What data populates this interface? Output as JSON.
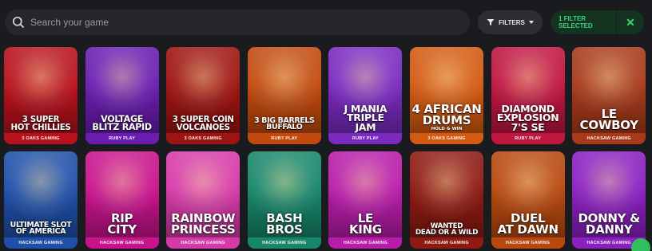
{
  "search": {
    "placeholder": "Search your game"
  },
  "filters": {
    "label": "FILTERS"
  },
  "filter_selected": {
    "label": "1 FILTER SELECTED",
    "close": "✕"
  },
  "games": [
    {
      "title_lines": [
        "3 SUPER",
        "HOT CHILLIES"
      ],
      "sub": "",
      "provider": "3 OAKS GAMING",
      "bg": "#b8121c"
    },
    {
      "title_lines": [
        "VOLTAGE",
        "BLITZ RAPID"
      ],
      "sub": "",
      "provider": "RUBY PLAY",
      "bg": "#6a1db0"
    },
    {
      "title_lines": [
        "3 SUPER COIN",
        "VOLCANOES"
      ],
      "sub": "",
      "provider": "3 OAKS GAMING",
      "bg": "#9e1410"
    },
    {
      "title_lines": [
        "3 BIG BARRELS",
        "BUFFALO"
      ],
      "sub": "",
      "provider": "RUBY PLAY",
      "bg": "#c24a0e"
    },
    {
      "title_lines": [
        "J MANIA",
        "TRIPLE",
        "JAM"
      ],
      "sub": "",
      "provider": "RUBY PLAY",
      "bg": "#7a2ac0"
    },
    {
      "title_lines": [
        "4 AFRICAN",
        "DRUMS"
      ],
      "sub": "HOLD & WIN",
      "provider": "3 OAKS GAMING",
      "bg": "#d35a10"
    },
    {
      "title_lines": [
        "DIAMOND",
        "EXPLOSION",
        "7'S SE"
      ],
      "sub": "",
      "provider": "RUBY PLAY",
      "bg": "#c01640"
    },
    {
      "title_lines": [
        "LE",
        "COWBOY"
      ],
      "sub": "",
      "provider": "HACKSAW GAMING",
      "bg": "#a83a1a"
    },
    {
      "title_lines": [
        "ULTIMATE SLOT",
        "OF AMERICA"
      ],
      "sub": "",
      "provider": "HACKSAW GAMING",
      "bg": "#1f4fa8"
    },
    {
      "title_lines": [
        "RIP",
        "CITY"
      ],
      "sub": "",
      "provider": "HACKSAW GAMING",
      "bg": "#c8138c"
    },
    {
      "title_lines": [
        "RAINBOW",
        "PRINCESS"
      ],
      "sub": "",
      "provider": "HACKSAW GAMING",
      "bg": "#d63aa8"
    },
    {
      "title_lines": [
        "BASH",
        "BROS"
      ],
      "sub": "",
      "provider": "HACKSAW GAMING",
      "bg": "#17866a"
    },
    {
      "title_lines": [
        "LE",
        "KING"
      ],
      "sub": "",
      "provider": "HACKSAW GAMING",
      "bg": "#b81ca8"
    },
    {
      "title_lines": [
        "WANTED",
        "DEAD OR A WILD"
      ],
      "sub": "",
      "provider": "HACKSAW GAMING",
      "bg": "#8e1a12"
    },
    {
      "title_lines": [
        "DUEL",
        "AT DAWN"
      ],
      "sub": "",
      "provider": "HACKSAW GAMING",
      "bg": "#b8480e"
    },
    {
      "title_lines": [
        "DONNY &",
        "DANNY"
      ],
      "sub": "",
      "provider": "HACKSAW GAMING",
      "bg": "#8a20c0"
    }
  ]
}
